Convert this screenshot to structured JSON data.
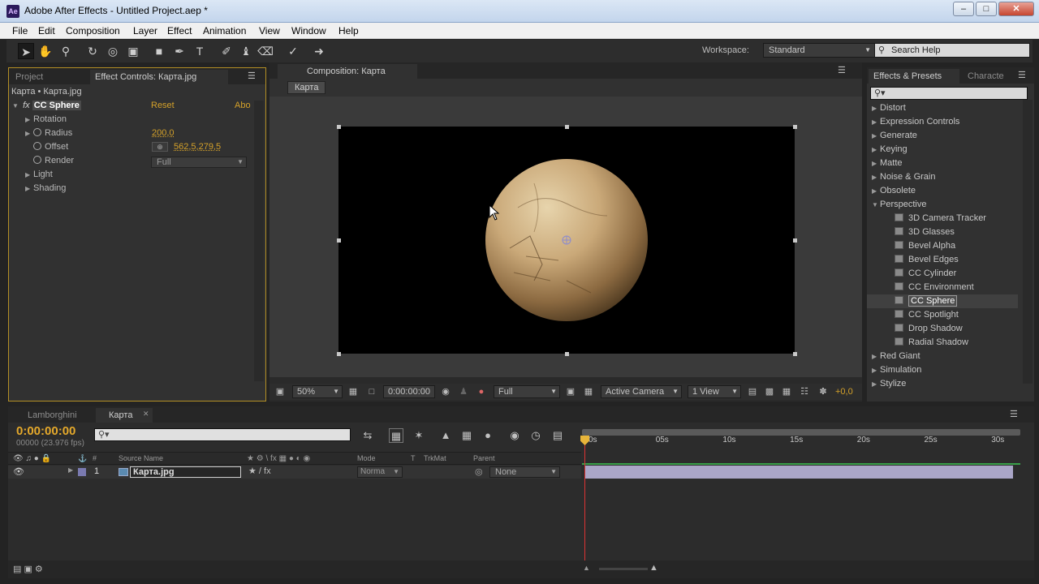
{
  "window": {
    "app_icon": "Ae",
    "title": "Adobe After Effects - Untitled Project.aep *",
    "controls": [
      "minimize",
      "maximize",
      "close"
    ]
  },
  "menu": [
    "File",
    "Edit",
    "Composition",
    "Layer",
    "Effect",
    "Animation",
    "View",
    "Window",
    "Help"
  ],
  "toolbar": {
    "workspace_label": "Workspace:",
    "workspace_value": "Standard",
    "search_help": "Search Help"
  },
  "effect_controls": {
    "tabs": [
      "Project",
      "Effect Controls: Карта.jpg"
    ],
    "breadcrumb": "Карта • Карта.jpg",
    "effect_name": "CC Sphere",
    "reset": "Reset",
    "about": "Abo",
    "properties": [
      {
        "label": "Rotation",
        "value": ""
      },
      {
        "label": "Radius",
        "value": "200,0"
      },
      {
        "label": "Offset",
        "value": "562,5,279,5"
      },
      {
        "label": "Render",
        "value": "Full"
      },
      {
        "label": "Light",
        "value": ""
      },
      {
        "label": "Shading",
        "value": ""
      }
    ]
  },
  "composition": {
    "tab": "Composition: Карта",
    "crumb": "Карта",
    "footer": {
      "zoom": "50%",
      "timecode": "0:00:00:00",
      "resolution": "Full",
      "camera": "Active Camera",
      "views": "1 View",
      "exposure": "+0,0"
    }
  },
  "effects_presets": {
    "tabs": [
      "Effects & Presets",
      "Characte"
    ],
    "categories_top": [
      "Distort",
      "Expression Controls",
      "Generate",
      "Keying",
      "Matte",
      "Noise & Grain",
      "Obsolete",
      "Perspective"
    ],
    "perspective_items": [
      "3D Camera Tracker",
      "3D Glasses",
      "Bevel Alpha",
      "Bevel Edges",
      "CC Cylinder",
      "CC Environment",
      "CC Sphere",
      "CC Spotlight",
      "Drop Shadow",
      "Radial Shadow"
    ],
    "selected_item": "CC Sphere",
    "categories_bottom": [
      "Red Giant",
      "Simulation",
      "Stylize"
    ]
  },
  "timeline": {
    "tabs": [
      "Lamborghini",
      "Карта"
    ],
    "timecode": "0:00:00:00",
    "frames": "00000 (23.976 fps)",
    "columns": [
      "#",
      "Source Name",
      "Mode",
      "T",
      "TrkMat",
      "Parent"
    ],
    "layer": {
      "index": "1",
      "name": "Карта.jpg",
      "mode": "Norma",
      "parent": "None"
    },
    "ruler_labels": [
      "0s",
      "05s",
      "10s",
      "15s",
      "20s",
      "25s",
      "30s"
    ]
  }
}
